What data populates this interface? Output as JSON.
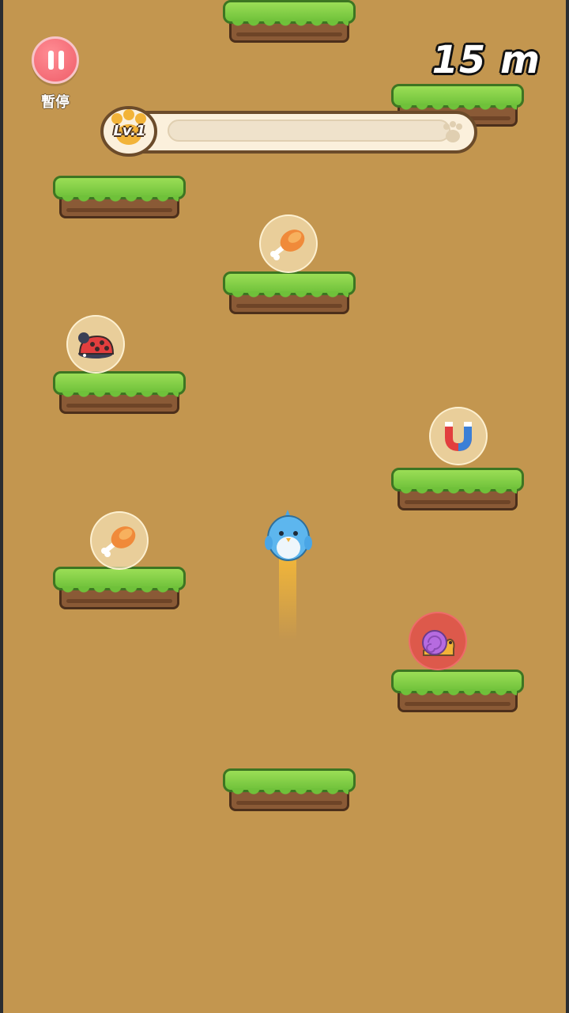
{
  "hud": {
    "pause_label": "暫停",
    "distance": "15 m",
    "level_label": "Lv.1",
    "level_progress": 0
  },
  "sprites": {
    "player": "blue-bird",
    "items": [
      "chicken-leg",
      "ladybug",
      "magnet",
      "chicken-leg",
      "snail"
    ]
  },
  "colors": {
    "background": "#c3964f",
    "grass": "#7fcd45",
    "dirt": "#8a5a36",
    "pause_button": "#ef5d69",
    "trail": "#f0b53a"
  }
}
